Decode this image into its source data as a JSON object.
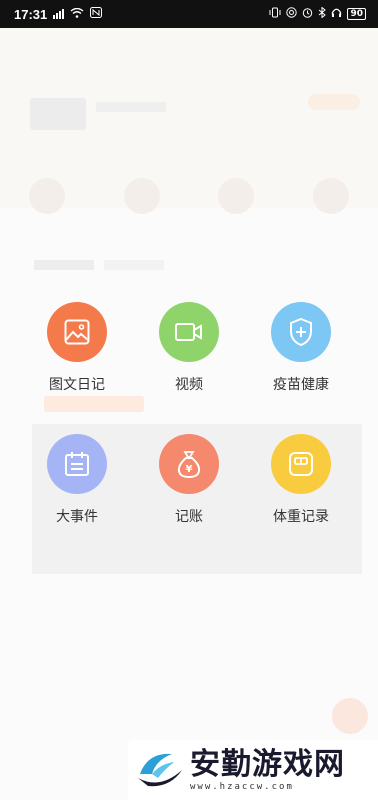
{
  "status_bar": {
    "time": "17:31",
    "left_indicators": "•",
    "battery": "90"
  },
  "menu": {
    "items": [
      {
        "label": "图文日记",
        "icon": "image-icon",
        "color": "#f47a4b"
      },
      {
        "label": "视频",
        "icon": "video-camera-icon",
        "color": "#8fd46a"
      },
      {
        "label": "疫苗健康",
        "icon": "shield-plus-icon",
        "color": "#7cc7f4"
      },
      {
        "label": "大事件",
        "icon": "calendar-icon",
        "color": "#a4b4f5"
      },
      {
        "label": "记账",
        "icon": "money-bag-icon",
        "color": "#f4896e"
      },
      {
        "label": "体重记录",
        "icon": "scale-icon",
        "color": "#f8cc3e"
      }
    ]
  },
  "watermark": {
    "title": "安勤游戏网",
    "url": "www.hzaccw.com"
  }
}
